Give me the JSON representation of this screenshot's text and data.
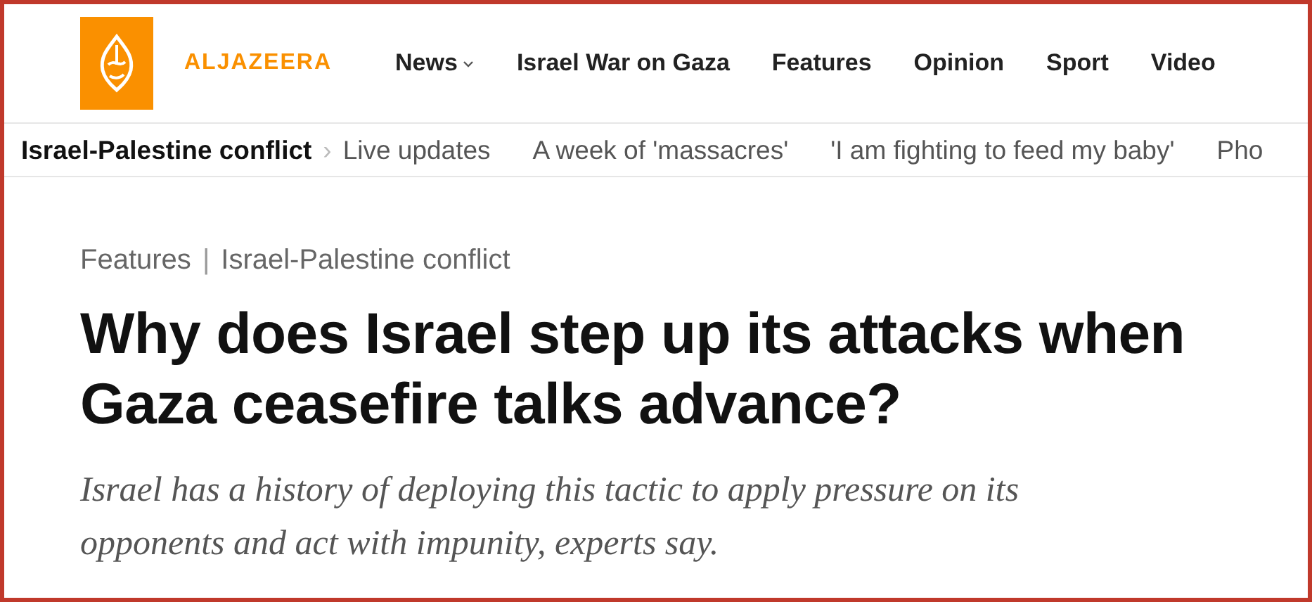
{
  "header": {
    "logo_text": "ALJAZEERA",
    "nav": [
      {
        "label": "News",
        "dropdown": true
      },
      {
        "label": "Israel War on Gaza",
        "dropdown": false
      },
      {
        "label": "Features",
        "dropdown": false
      },
      {
        "label": "Opinion",
        "dropdown": false
      },
      {
        "label": "Sport",
        "dropdown": false
      },
      {
        "label": "Video",
        "dropdown": false
      }
    ]
  },
  "subnav": {
    "topic": "Israel-Palestine conflict",
    "separator": "›",
    "links": [
      "Live updates",
      "A week of 'massacres'",
      "'I am fighting to feed my baby'",
      "Pho"
    ]
  },
  "article": {
    "breadcrumb": [
      "Features",
      "Israel-Palestine conflict"
    ],
    "breadcrumb_separator": "|",
    "headline": "Why does Israel step up its attacks when Gaza ceasefire talks advance?",
    "standfirst": "Israel has a history of deploying this tactic to apply pressure on its opponents and act with impunity, experts say."
  }
}
